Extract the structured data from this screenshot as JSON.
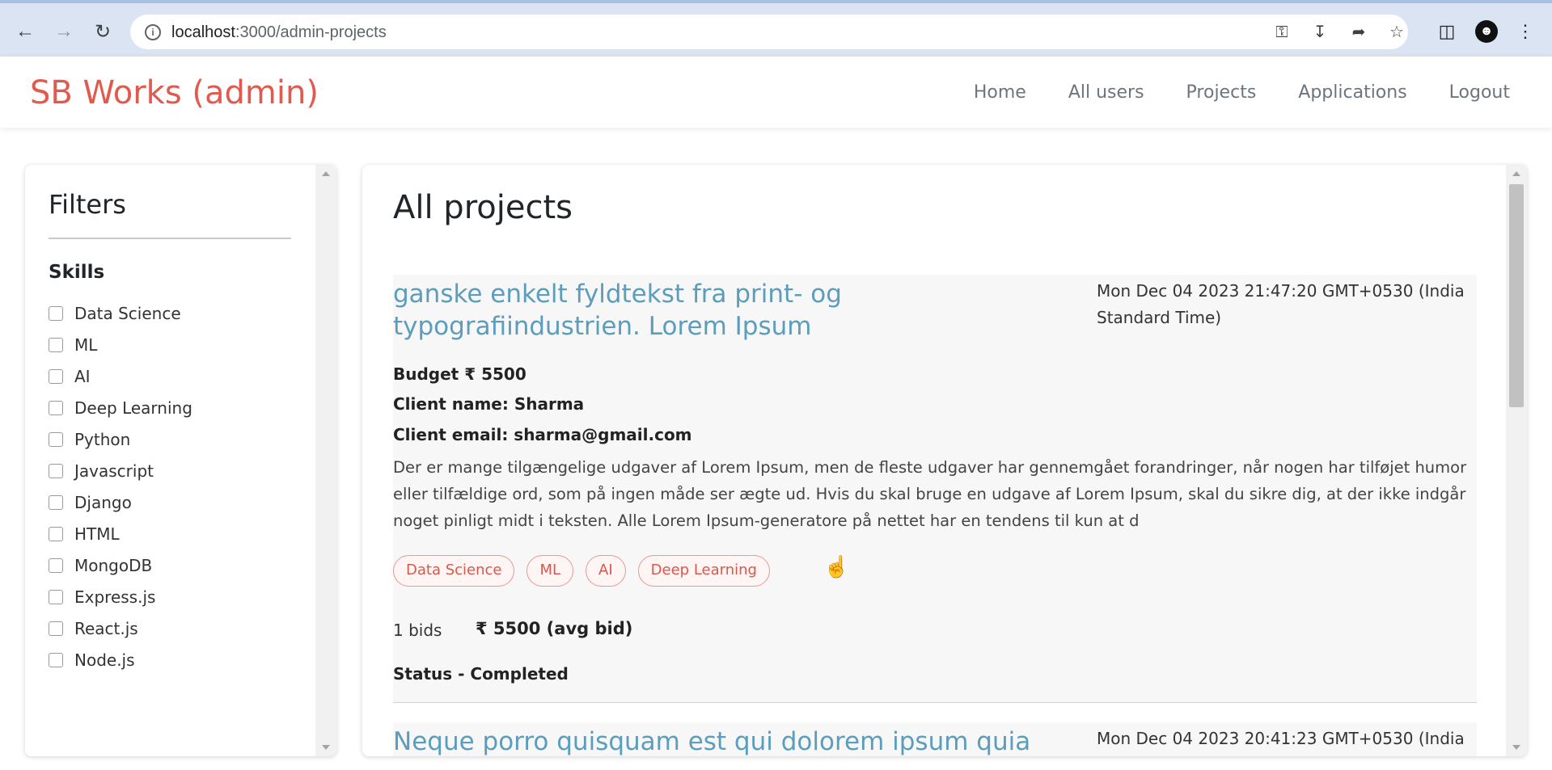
{
  "browser": {
    "url_host": "localhost",
    "url_path": ":3000/admin-projects"
  },
  "header": {
    "brand": "SB Works (admin)",
    "nav": [
      "Home",
      "All users",
      "Projects",
      "Applications",
      "Logout"
    ]
  },
  "filters": {
    "title": "Filters",
    "skills_title": "Skills",
    "skills": [
      "Data Science",
      "ML",
      "AI",
      "Deep Learning",
      "Python",
      "Javascript",
      "Django",
      "HTML",
      "MongoDB",
      "Express.js",
      "React.js",
      "Node.js"
    ]
  },
  "projects": {
    "title": "All projects",
    "items": [
      {
        "title": "ganske enkelt fyldtekst fra print- og typografiindustrien. Lorem Ipsum",
        "date": "Mon Dec 04 2023 21:47:20 GMT+0530 (India Standard Time)",
        "budget": "Budget ₹ 5500",
        "client_name": "Client name: Sharma",
        "client_email": "Client email: sharma@gmail.com",
        "description": "Der er mange tilgængelige udgaver af Lorem Ipsum, men de fleste udgaver har gennemgået forandringer, når nogen har tilføjet humor eller tilfældige ord, som på ingen måde ser ægte ud. Hvis du skal bruge en udgave af Lorem Ipsum, skal du sikre dig, at der ikke indgår noget pinligt midt i teksten. Alle Lorem Ipsum-generatore på nettet har en tendens til kun at d",
        "tags": [
          "Data Science",
          "ML",
          "AI",
          "Deep Learning"
        ],
        "bids": "1 bids",
        "avg_bid": "₹ 5500 (avg bid)",
        "status": "Status - Completed"
      },
      {
        "title": "Neque porro quisquam est qui dolorem ipsum quia",
        "date": "Mon Dec 04 2023 20:41:23 GMT+0530 (India"
      }
    ]
  }
}
